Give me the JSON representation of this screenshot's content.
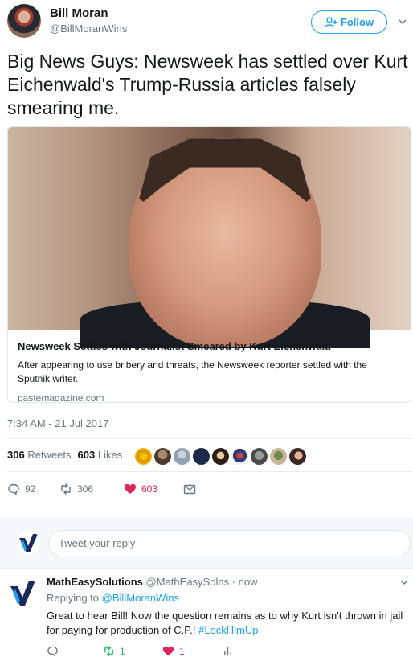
{
  "author": {
    "name": "Bill Moran",
    "handle": "@BillMoranWins",
    "follow_label": "Follow"
  },
  "tweet": {
    "text": "Big News Guys: Newsweek has settled over Kurt Eichenwald's Trump-Russia articles falsely smearing me.",
    "timestamp": "7:34 AM - 21 Jul 2017"
  },
  "card": {
    "title": "Newsweek Settles with Journalist Smeared by Kurt Eichenwald",
    "description": "After appearing to use bribery and threats, the Newsweek reporter settled with the Sputnik writer.",
    "domain": "pastemagazine.com"
  },
  "stats": {
    "retweets_count": "306",
    "retweets_label": "Retweets",
    "likes_count": "603",
    "likes_label": "Likes"
  },
  "actions": {
    "replies": "92",
    "retweets": "306",
    "likes": "603"
  },
  "reply_box": {
    "placeholder": "Tweet your reply"
  },
  "reply": {
    "name": "MathEasySolutions",
    "handle": "@MathEasySolns",
    "time": "· now",
    "replying_prefix": "Replying to",
    "replying_to": "@BillMoranWins",
    "text": "Great to hear Bill! Now the question remains as to why Kurt isn't thrown in jail for paying for production of C.P.!",
    "hashtag": "#LockHimUp",
    "retweets": "1",
    "likes": "1"
  },
  "colors": {
    "accent": "#1da1f2",
    "like": "#e0245e",
    "retweet": "#17bf63",
    "muted": "#657786"
  },
  "icons": [
    "chevron-down-icon",
    "add-user-icon",
    "reply-icon",
    "retweet-icon",
    "heart-icon",
    "message-icon",
    "analytics-icon"
  ]
}
